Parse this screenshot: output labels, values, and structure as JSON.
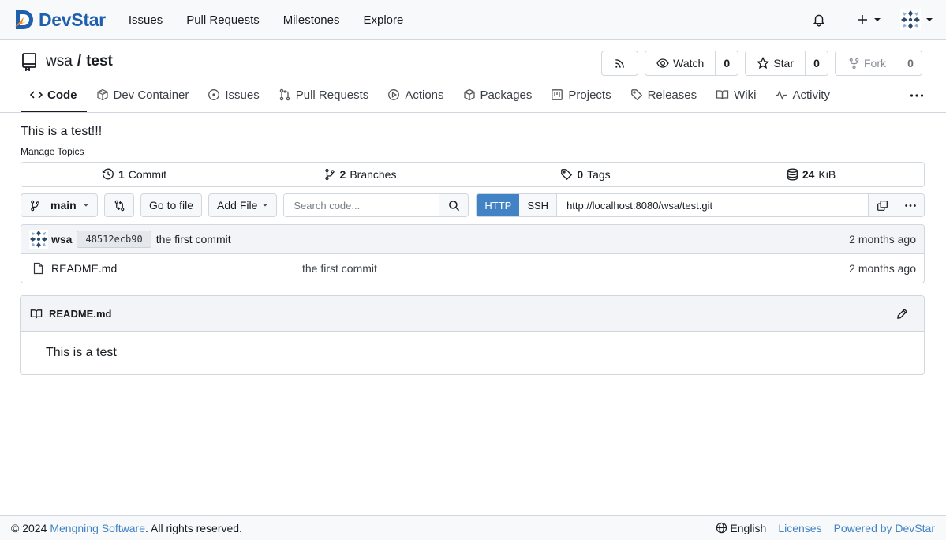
{
  "navbar": {
    "brand": "DevStar",
    "links": [
      "Issues",
      "Pull Requests",
      "Milestones",
      "Explore"
    ]
  },
  "repo": {
    "owner": "wsa",
    "separator": "/",
    "name": "test",
    "description": "This is a test!!!",
    "manage_topics": "Manage Topics",
    "actions": {
      "watch_label": "Watch",
      "watch_count": "0",
      "star_label": "Star",
      "star_count": "0",
      "fork_label": "Fork",
      "fork_count": "0"
    }
  },
  "tabs": [
    {
      "label": "Code"
    },
    {
      "label": "Dev Container"
    },
    {
      "label": "Issues"
    },
    {
      "label": "Pull Requests"
    },
    {
      "label": "Actions"
    },
    {
      "label": "Packages"
    },
    {
      "label": "Projects"
    },
    {
      "label": "Releases"
    },
    {
      "label": "Wiki"
    },
    {
      "label": "Activity"
    }
  ],
  "stats": {
    "commits_count": "1",
    "commits_label": "Commit",
    "branches_count": "2",
    "branches_label": "Branches",
    "tags_count": "0",
    "tags_label": "Tags",
    "size_count": "24",
    "size_label": "KiB"
  },
  "toolbar": {
    "branch": "main",
    "goto_file": "Go to file",
    "add_file": "Add File",
    "search_placeholder": "Search code...",
    "http": "HTTP",
    "ssh": "SSH",
    "clone_url": "http://localhost:8080/wsa/test.git"
  },
  "latest_commit": {
    "author": "wsa",
    "sha": "48512ecb90",
    "message": "the first commit",
    "time": "2 months ago"
  },
  "files": [
    {
      "name": "README.md",
      "message": "the first commit",
      "time": "2 months ago"
    }
  ],
  "readme": {
    "title": "README.md",
    "body": "This is a test"
  },
  "footer": {
    "copyright_prefix": "© 2024",
    "company": "Mengning Software",
    "rights": ". All rights reserved.",
    "language": "English",
    "licenses": "Licenses",
    "powered": "Powered by DevStar"
  },
  "colors": {
    "brand": "#1f5fae",
    "brand_accent": "#f08a24",
    "link": "#4183c4",
    "active_proto": "#4183c4"
  }
}
